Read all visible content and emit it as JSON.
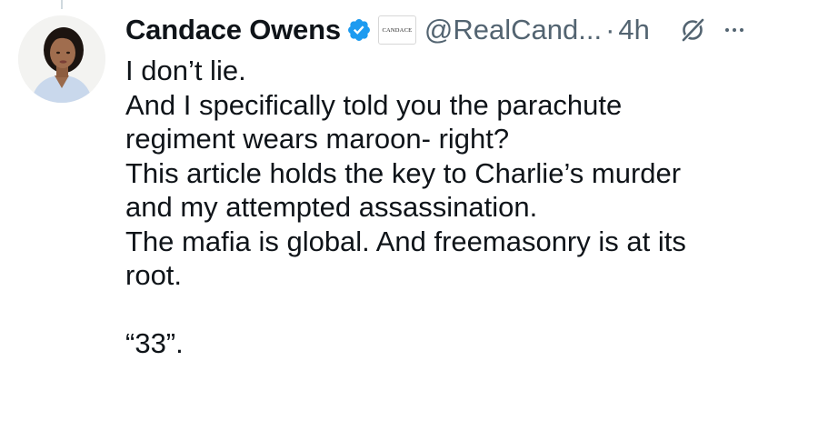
{
  "author": {
    "display_name": "Candace Owens",
    "handle": "@RealCand...",
    "affiliate_badge_text": "CANDACE",
    "verified_color": "#1d9bf0"
  },
  "meta": {
    "separator": "·",
    "time": "4h"
  },
  "icons": {
    "verified": "verified-badge-icon",
    "grok": "grok-icon",
    "more": "more-options-icon"
  },
  "tweet": {
    "lines": [
      "I don’t lie.",
      "And I specifically told you the parachute",
      "regiment wears maroon- right?",
      "This article holds the key to Charlie’s murder",
      "and my attempted assassination.",
      "The mafia is global. And freemasonry is at its",
      "root.",
      "",
      "“33”."
    ]
  }
}
